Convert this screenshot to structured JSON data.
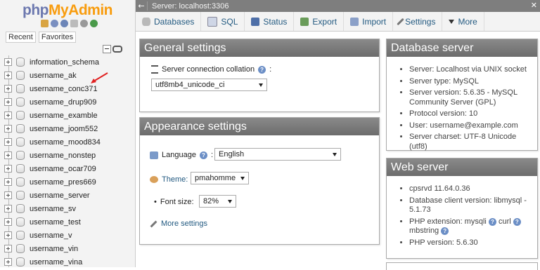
{
  "nav": {
    "logo_php": "php",
    "logo_myadmin": "MyAdmin",
    "tabs": [
      "Recent",
      "Favorites"
    ],
    "databases": [
      "information_schema",
      "username_ak",
      "username_conc371",
      "username_drup909",
      "username_examble",
      "username_joom552",
      "username_mood834",
      "username_nonstep",
      "username_ocar709",
      "username_pres669",
      "username_server",
      "username_sv",
      "username_test",
      "username_v",
      "username_vin",
      "username_vina"
    ]
  },
  "topbar": {
    "server_label": "Server: localhost:3306"
  },
  "menu": [
    {
      "label": "Databases",
      "icon": "database-icon"
    },
    {
      "label": "SQL",
      "icon": "sql-icon"
    },
    {
      "label": "Status",
      "icon": "status-icon"
    },
    {
      "label": "Export",
      "icon": "export-icon"
    },
    {
      "label": "Import",
      "icon": "import-icon"
    },
    {
      "label": "Settings",
      "icon": "wrench-icon"
    },
    {
      "label": "More",
      "icon": "chevron-down-icon"
    }
  ],
  "general": {
    "title": "General settings",
    "collation_label": "Server connection collation",
    "collation_suffix": ":",
    "collation_value": "utf8mb4_unicode_ci"
  },
  "appearance": {
    "title": "Appearance settings",
    "language_label": "Language",
    "language_suffix": ":",
    "language_value": "English",
    "theme_label": "Theme:",
    "theme_value": "pmahomme",
    "font_label": "Font size:",
    "font_value": "82%",
    "more_settings": "More settings"
  },
  "dbserver": {
    "title": "Database server",
    "items": [
      "Server: Localhost via UNIX socket",
      "Server type: MySQL",
      "Server version: 5.6.35 - MySQL Community Server (GPL)",
      "Protocol version: 10",
      "User: username@example.com",
      "Server charset: UTF-8 Unicode (utf8)"
    ]
  },
  "webserver": {
    "title": "Web server",
    "items": [
      "cpsrvd 11.64.0.36",
      "Database client version: libmysql - 5.1.73",
      "PHP extension: mysqli",
      "PHP version: 5.6.30"
    ],
    "php_ext_curl": "curl",
    "php_ext_mbstring": "mbstring"
  },
  "colors": {
    "link": "#235a81",
    "panel_header": "#7a7a7a",
    "annotation_arrow": "#e02020"
  }
}
